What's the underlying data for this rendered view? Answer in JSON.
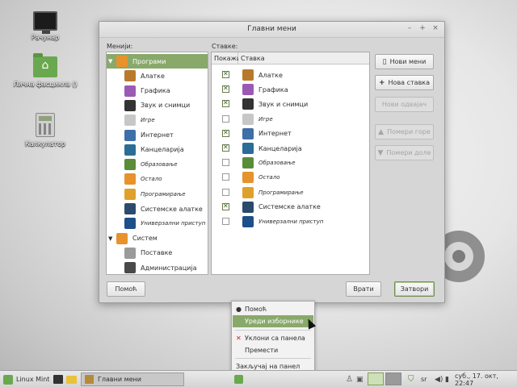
{
  "desktop": {
    "icons": [
      {
        "label": "Рачунар",
        "icon": "monitor-icon"
      },
      {
        "label": "Лична фасцикла ()",
        "icon": "home-folder-icon"
      },
      {
        "label": "Калкулатор",
        "icon": "calculator-icon"
      }
    ]
  },
  "window": {
    "title": "Главни мени",
    "controls": {
      "minimize": "–",
      "maximize": "+",
      "close": "×"
    },
    "menus_label": "Менији:",
    "items_label": "Ставке:",
    "tree": [
      {
        "label": "Програми",
        "level": 0,
        "expanded": true,
        "selected": true,
        "icon": "programs-icon",
        "italic": false
      },
      {
        "label": "Алатке",
        "level": 1,
        "icon": "accessories-icon",
        "italic": false
      },
      {
        "label": "Графика",
        "level": 1,
        "icon": "graphics-icon",
        "italic": false
      },
      {
        "label": "Звук и снимци",
        "level": 1,
        "icon": "multimedia-icon",
        "italic": false
      },
      {
        "label": "Игре",
        "level": 1,
        "icon": "games-icon",
        "italic": true
      },
      {
        "label": "Интернет",
        "level": 1,
        "icon": "internet-icon",
        "italic": false
      },
      {
        "label": "Канцеларија",
        "level": 1,
        "icon": "office-icon",
        "italic": false
      },
      {
        "label": "Образовање",
        "level": 1,
        "icon": "education-icon",
        "italic": true
      },
      {
        "label": "Остало",
        "level": 1,
        "icon": "other-icon",
        "italic": true
      },
      {
        "label": "Програмирање",
        "level": 1,
        "icon": "programming-icon",
        "italic": true
      },
      {
        "label": "Системске алатке",
        "level": 1,
        "icon": "system-tools-icon",
        "italic": false
      },
      {
        "label": "Универзални приступ",
        "level": 1,
        "icon": "accessibility-icon",
        "italic": true
      },
      {
        "label": "Систем",
        "level": 0,
        "expanded": true,
        "selected": false,
        "icon": "system-icon",
        "italic": false
      },
      {
        "label": "Поставке",
        "level": 1,
        "icon": "preferences-icon",
        "italic": false
      },
      {
        "label": "Администрација",
        "level": 1,
        "icon": "administration-icon",
        "italic": false
      }
    ],
    "items_columns": {
      "show": "Покажи",
      "item": "Ставка"
    },
    "items": [
      {
        "label": "Алатке",
        "checked": true,
        "icon": "accessories-icon",
        "italic": false
      },
      {
        "label": "Графика",
        "checked": true,
        "icon": "graphics-icon",
        "italic": false
      },
      {
        "label": "Звук и снимци",
        "checked": true,
        "icon": "multimedia-icon",
        "italic": false
      },
      {
        "label": "Игре",
        "checked": false,
        "icon": "games-icon",
        "italic": true
      },
      {
        "label": "Интернет",
        "checked": true,
        "icon": "internet-icon",
        "italic": false
      },
      {
        "label": "Канцеларија",
        "checked": true,
        "icon": "office-icon",
        "italic": false
      },
      {
        "label": "Образовање",
        "checked": false,
        "icon": "education-icon",
        "italic": true
      },
      {
        "label": "Остало",
        "checked": false,
        "icon": "other-icon",
        "italic": true
      },
      {
        "label": "Програмирање",
        "checked": false,
        "icon": "programming-icon",
        "italic": true
      },
      {
        "label": "Системске алатке",
        "checked": true,
        "icon": "system-tools-icon",
        "italic": false
      },
      {
        "label": "Универзални приступ",
        "checked": false,
        "icon": "accessibility-icon",
        "italic": true
      }
    ],
    "buttons": {
      "new_menu": "Нови мени",
      "new_item": "Нова ставка",
      "new_separator": "Нови одвајач",
      "move_up": "Помери горе",
      "move_down": "Помери доле",
      "help": "Помоћ",
      "revert": "Врати",
      "close": "Затвори"
    }
  },
  "context_menu": {
    "items": [
      {
        "label": "Помоћ",
        "icon": "help-icon",
        "highlighted": false
      },
      {
        "label": "Уреди изборнике",
        "icon": "",
        "highlighted": true
      },
      {
        "label": "Уклони са панела",
        "icon": "remove-icon",
        "highlighted": false
      },
      {
        "label": "Премести",
        "icon": "",
        "highlighted": false
      },
      {
        "label": "Закључај на панел",
        "icon": "",
        "highlighted": false
      }
    ]
  },
  "taskbar": {
    "menu_label": "Linux Mint",
    "window_button": "Главни мени",
    "keyboard_layout": "sr",
    "clock": "суб., 17. окт, 22:47"
  },
  "colors": {
    "accent": "#89a96b",
    "check": "#3d6b1f"
  }
}
